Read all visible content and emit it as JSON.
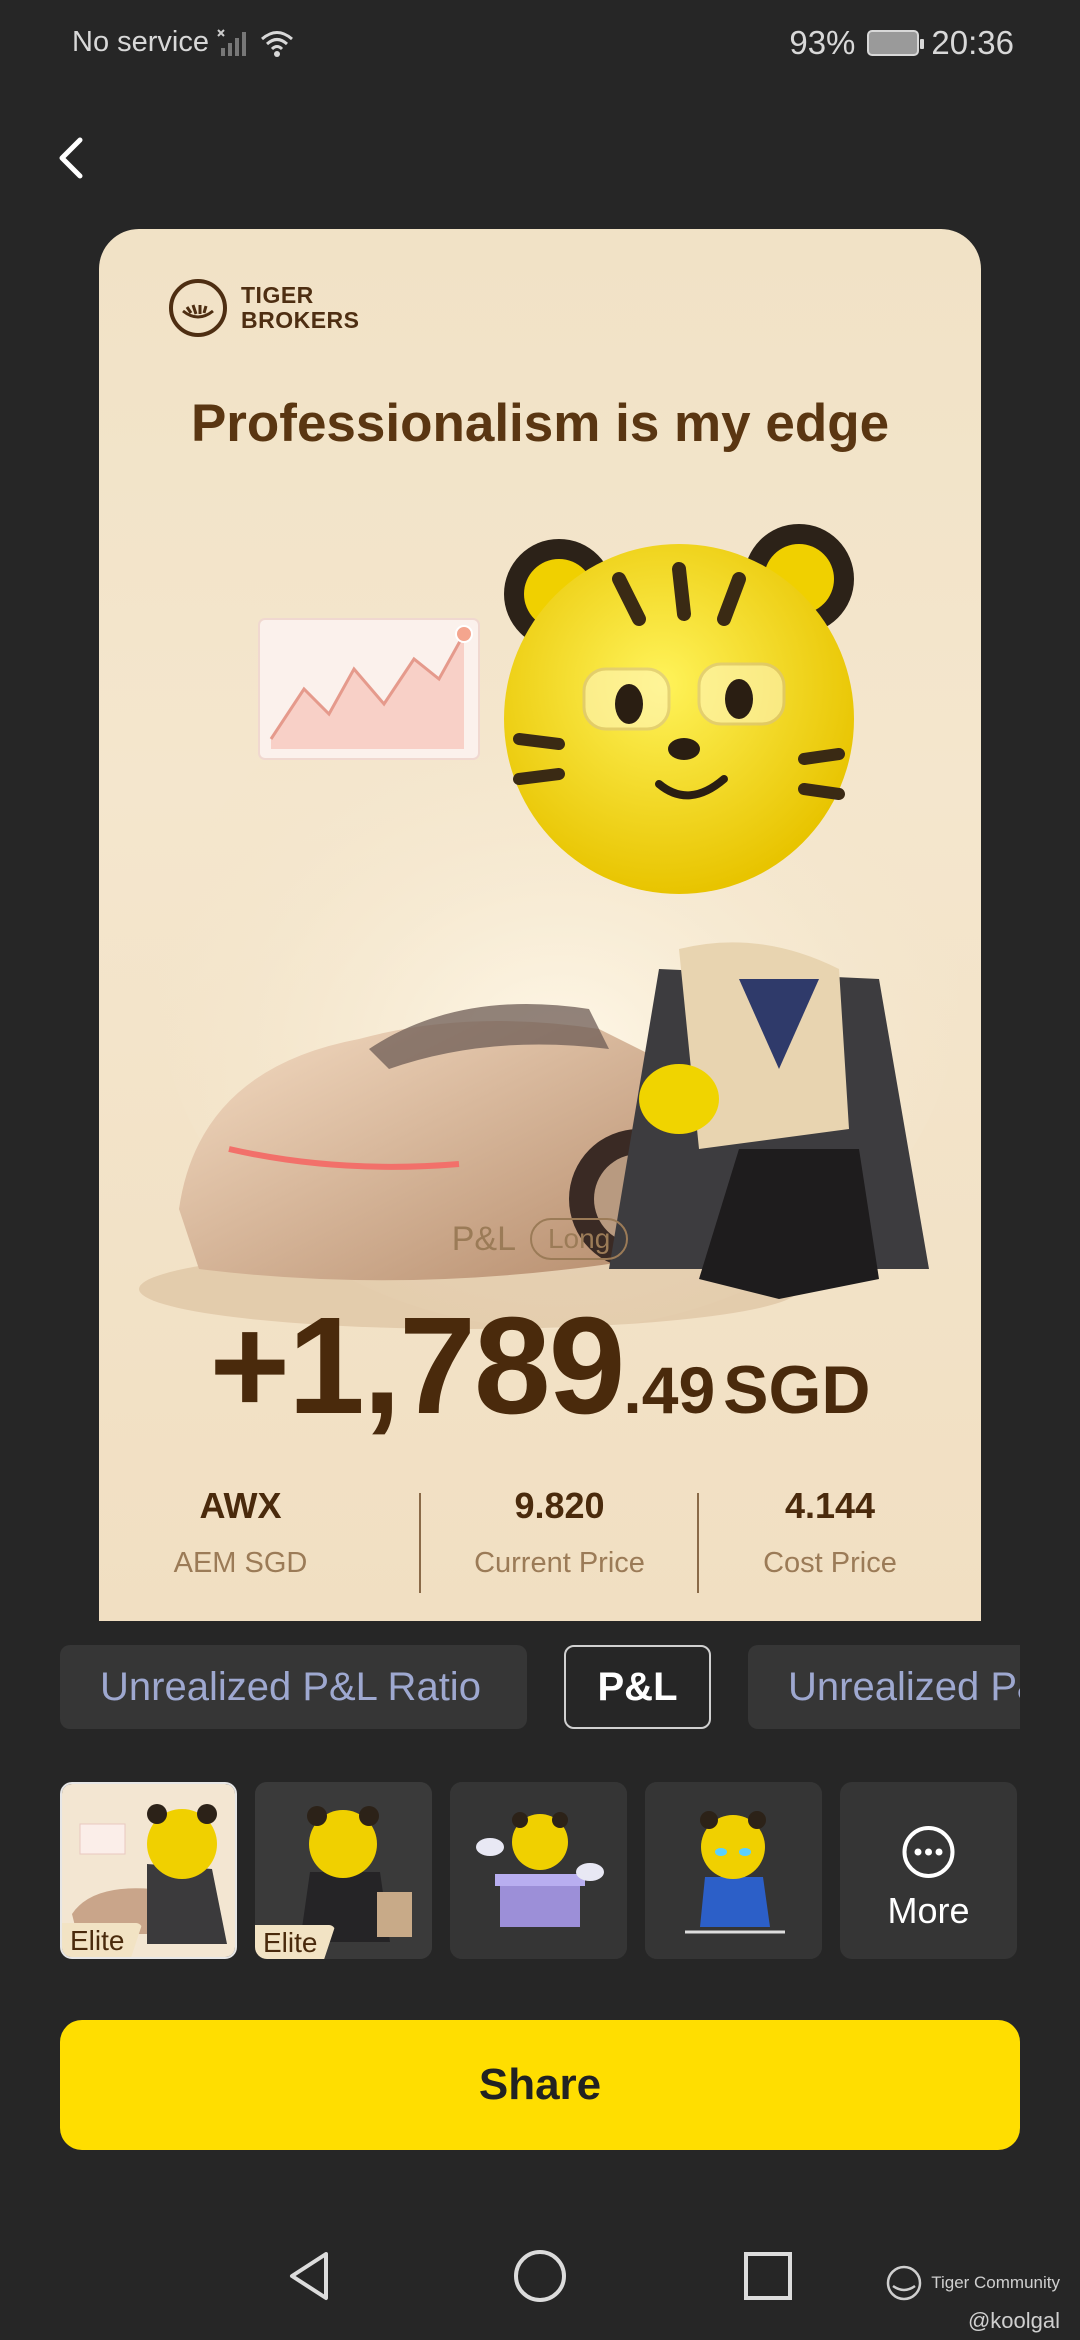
{
  "status_bar": {
    "carrier": "No service",
    "battery": "93%",
    "time": "20:36"
  },
  "card": {
    "brand_line1": "TIGER",
    "brand_line2": "BROKERS",
    "headline": "Professionalism is my edge",
    "pl_label": "P&L",
    "position_badge": "Long",
    "amount_sign_int": "+1,789",
    "amount_decimal": ".49",
    "amount_currency": "SGD",
    "stats": [
      {
        "value": "AWX",
        "label": "AEM SGD"
      },
      {
        "value": "9.820",
        "label": "Current Price"
      },
      {
        "value": "4.144",
        "label": "Cost Price"
      }
    ]
  },
  "tabs": [
    {
      "label": "Unrealized P&L Ratio",
      "active": false
    },
    {
      "label": "P&L",
      "active": true
    },
    {
      "label": "Unrealized P&L",
      "active": false
    }
  ],
  "templates": [
    {
      "badge": "Elite",
      "selected": true
    },
    {
      "badge": "Elite",
      "selected": false
    },
    {
      "badge": "",
      "selected": false
    },
    {
      "badge": "",
      "selected": false
    }
  ],
  "more_label": "More",
  "share_label": "Share",
  "watermark": {
    "community": "Tiger Community",
    "user": "@koolgal"
  },
  "colors": {
    "accent": "#ffde00",
    "card_bg": "#f1e2c6",
    "page_bg": "#262626"
  }
}
